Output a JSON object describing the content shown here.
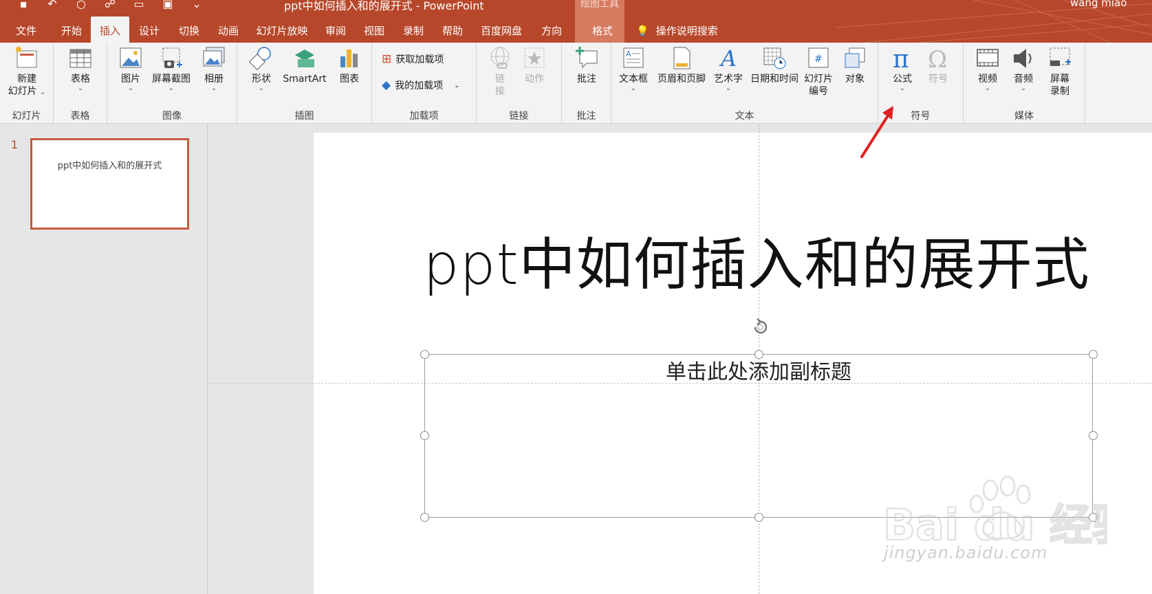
{
  "app": {
    "window_title": "ppt中如何插入和的展开式 - PowerPoint",
    "context_tab_group": "绘图工具",
    "user": "wang miao"
  },
  "tabs": [
    {
      "label": "文件"
    },
    {
      "label": "开始"
    },
    {
      "label": "插入",
      "active": true
    },
    {
      "label": "设计"
    },
    {
      "label": "切换"
    },
    {
      "label": "动画"
    },
    {
      "label": "幻灯片放映"
    },
    {
      "label": "审阅"
    },
    {
      "label": "视图"
    },
    {
      "label": "录制"
    },
    {
      "label": "帮助"
    },
    {
      "label": "百度网盘"
    },
    {
      "label": "方向"
    },
    {
      "label": "格式"
    }
  ],
  "tell_me": "操作说明搜索",
  "ribbon": {
    "slides": {
      "group": "幻灯片",
      "new_slide_line1": "新建",
      "new_slide_line2": "幻灯片"
    },
    "tables": {
      "group": "表格",
      "table": "表格"
    },
    "images": {
      "group": "图像",
      "picture": "图片",
      "screenshot": "屏幕截图",
      "album": "相册"
    },
    "illustrations": {
      "group": "插图",
      "shapes": "形状",
      "smartart": "SmartArt",
      "chart": "图表"
    },
    "addins": {
      "group": "加载项",
      "get_addins": "获取加载项",
      "my_addins": "我的加载项"
    },
    "links": {
      "group": "链接",
      "link_line1": "链",
      "link_line2": "接",
      "action": "动作"
    },
    "comments": {
      "group": "批注",
      "comment": "批注"
    },
    "text": {
      "group": "文本",
      "textbox": "文本框",
      "header_footer": "页眉和页脚",
      "wordart": "艺术字",
      "datetime": "日期和时间",
      "slide_num_line1": "幻灯片",
      "slide_num_line2": "编号",
      "object": "对象"
    },
    "symbols": {
      "group": "符号",
      "equation": "公式",
      "symbol": "符号"
    },
    "media": {
      "group": "媒体",
      "video": "视频",
      "audio": "音频",
      "screen_rec_line1": "屏幕",
      "screen_rec_line2": "录制"
    }
  },
  "thumbnails": [
    {
      "number": "1",
      "title": "ppt中如何插入和的展开式"
    }
  ],
  "slide": {
    "title": "ppt中如何插入和的展开式",
    "subtitle_placeholder": "单击此处添加副标题"
  },
  "watermark": {
    "brand": "Bai du 经验",
    "url": "jingyan.baidu.com"
  },
  "colors": {
    "accent": "#b7472a",
    "ribbon_bg": "#f3f3f3",
    "annotation_arrow": "#e02020"
  }
}
